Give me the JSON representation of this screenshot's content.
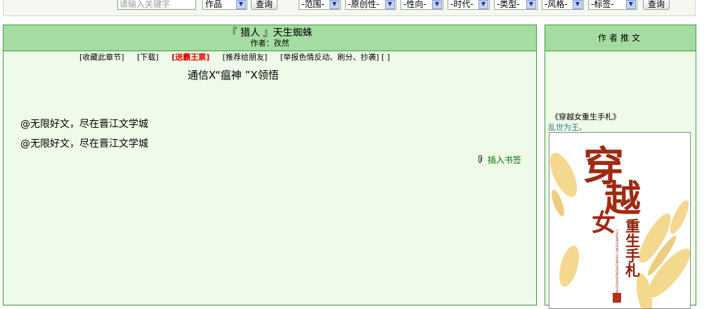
{
  "search": {
    "placeholder": "请输入关键字",
    "category_value": "作品",
    "query_label": "查询",
    "filters": [
      "-范围-",
      "-原创性-",
      "-性向-",
      "-时代-",
      "-类型-",
      "-风格-",
      "-标签-"
    ],
    "query2_label": "查询"
  },
  "chapter": {
    "novel_title": "『 猎人 』天生蜘蛛",
    "author_label": "作者：",
    "author_name": "孜然",
    "links": {
      "collect": "[收藏此章节]",
      "download": "[下载]",
      "gift": "[送霸王票]",
      "recommend": "[推荐给朋友]",
      "report": "[举报色情反动、刷分、抄袭] [               ]"
    },
    "title": "通信X“瘟神 ”X领悟",
    "paragraphs": [
      "@无限好文，尽在晋江文学城",
      "@无限好文，尽在晋江文学城"
    ],
    "bookmark_label": "插入书签"
  },
  "sidebar": {
    "header": "作者推文",
    "rec_title": "《穿越女重生手札》",
    "rec_subtitle": "乱世为王。",
    "cover_text": {
      "big1": "穿",
      "big2": "越",
      "small": "女",
      "subtitle": "重生手札",
      "pinyin": "CHUANYUENV CHONGSHENGSHOUZHA"
    }
  },
  "colors": {
    "panel_bg": "#edfbe8",
    "header_bg": "#a5dca2",
    "border": "#3e9a3e",
    "accent_red": "#e00000",
    "bookmark_green": "#0a6a0a"
  }
}
